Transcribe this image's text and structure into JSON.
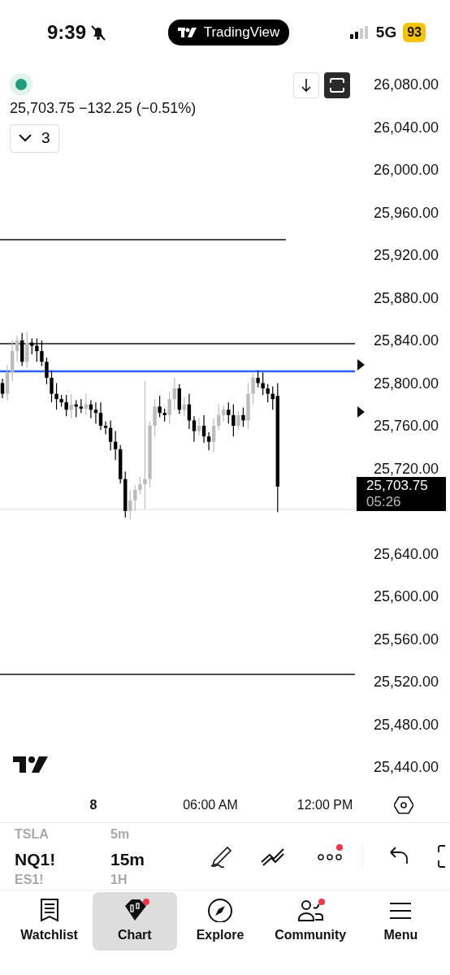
{
  "status_bar": {
    "time": "9:39",
    "muted": true,
    "app_pill": "TradingView",
    "network": "5G",
    "battery": "93"
  },
  "legend": {
    "status_dot": {
      "color": "#1f9e7d"
    },
    "price_line": "25,703.75 −132.25 (−0.51%)",
    "collapsed_count": "3"
  },
  "price_axis": [
    {
      "kind": "label",
      "text": "26,080.00"
    },
    {
      "kind": "label",
      "text": "26,040.00"
    },
    {
      "kind": "label",
      "text": "26,000.00"
    },
    {
      "kind": "label",
      "text": "25,960.00"
    },
    {
      "kind": "label",
      "text": "25,920.00"
    },
    {
      "kind": "label",
      "text": "25,880.00"
    },
    {
      "kind": "label",
      "text": "25,840.00"
    },
    {
      "kind": "label",
      "text": "25,800.00"
    },
    {
      "kind": "label",
      "text": "25,760.00"
    },
    {
      "kind": "label",
      "text": "25,720.00"
    },
    {
      "kind": "last_price",
      "price": "25,703.75",
      "countdown": "05:26"
    },
    {
      "kind": "label",
      "text": "25,640.00"
    },
    {
      "kind": "label",
      "text": "25,600.00"
    },
    {
      "kind": "label",
      "text": "25,560.00"
    },
    {
      "kind": "label",
      "text": "25,520.00"
    },
    {
      "kind": "label",
      "text": "25,480.00"
    },
    {
      "kind": "label",
      "text": "25,440.00"
    }
  ],
  "time_axis": [
    {
      "kind": "day",
      "text": "8"
    },
    {
      "kind": "time",
      "text": "06:00 AM"
    },
    {
      "kind": "time",
      "text": "12:00 PM"
    }
  ],
  "toolbar": {
    "symbols": [
      {
        "text": "TSLA",
        "selected": false
      },
      {
        "text": "NQ1!",
        "selected": true
      },
      {
        "text": "ES1!",
        "selected": false
      }
    ],
    "intervals": [
      {
        "text": "5m",
        "selected": false
      },
      {
        "text": "15m",
        "selected": true
      },
      {
        "text": "1H",
        "selected": false
      }
    ],
    "more_badge": true
  },
  "tab_bar": [
    {
      "label": "Watchlist",
      "selected": false,
      "badge": false
    },
    {
      "label": "Chart",
      "selected": true,
      "badge": true
    },
    {
      "label": "Explore",
      "selected": false,
      "badge": false
    },
    {
      "label": "Community",
      "selected": false,
      "badge": true
    },
    {
      "label": "Menu",
      "selected": false,
      "badge": false
    }
  ]
}
